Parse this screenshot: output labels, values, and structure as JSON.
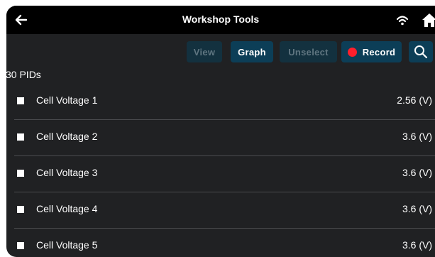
{
  "header": {
    "title": "Workshop Tools",
    "back_icon": "arrow-left-icon",
    "wifi_icon": "wifi-icon",
    "home_icon": "home-icon"
  },
  "toolbar": {
    "view_label": "View",
    "graph_label": "Graph",
    "unselect_label": "Unselect",
    "record_label": "Record",
    "search_icon": "search-icon"
  },
  "pids": {
    "count_label": "30 PIDs",
    "items": [
      {
        "name": "Cell Voltage 1",
        "value": "2.56 (V)"
      },
      {
        "name": "Cell Voltage 2",
        "value": "3.6 (V)"
      },
      {
        "name": "Cell Voltage 3",
        "value": "3.6 (V)"
      },
      {
        "name": "Cell Voltage 4",
        "value": "3.6 (V)"
      },
      {
        "name": "Cell Voltage 5",
        "value": "3.6 (V)"
      }
    ]
  },
  "colors": {
    "accent": "#0c3e57",
    "record": "#ff1f2c",
    "background": "#202123"
  }
}
